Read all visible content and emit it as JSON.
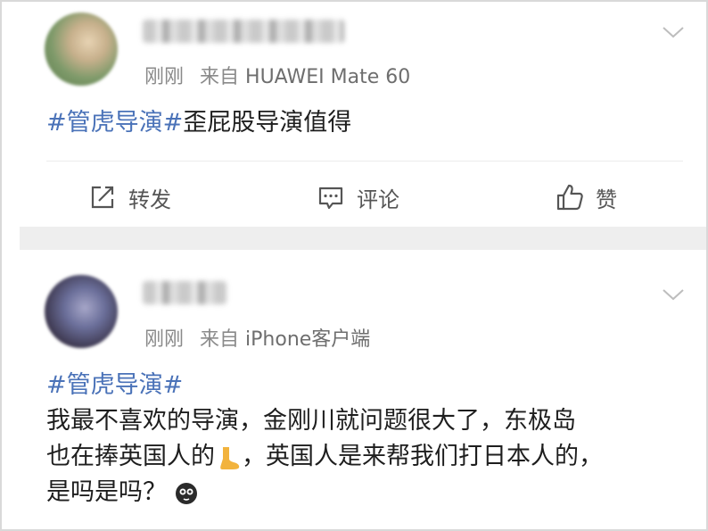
{
  "post1": {
    "time": "刚刚",
    "source_prefix": "来自",
    "device": "HUAWEI Mate 60",
    "hashtag": "#管虎导演#",
    "text": "歪屁股导演值得",
    "actions": {
      "repost": "转发",
      "comment": "评论",
      "like": "赞"
    }
  },
  "post2": {
    "time": "刚刚",
    "source_prefix": "来自",
    "device": "iPhone客户端",
    "hashtag": "#管虎导演#",
    "line1": "我最不喜欢的导演，金刚川就问题很大了，东极岛",
    "line2a": "也在捧英国人的",
    "line2b": "，英国人是来帮我们打日本人的，",
    "line3": "是吗是吗？"
  },
  "colors": {
    "link": "#4a72b8",
    "meta": "#8a8a8a",
    "gap": "#eeeeee"
  },
  "icons": [
    "chevron-down-icon",
    "repost-icon",
    "comment-icon",
    "like-icon",
    "foot-emoji",
    "skull-emoji"
  ]
}
